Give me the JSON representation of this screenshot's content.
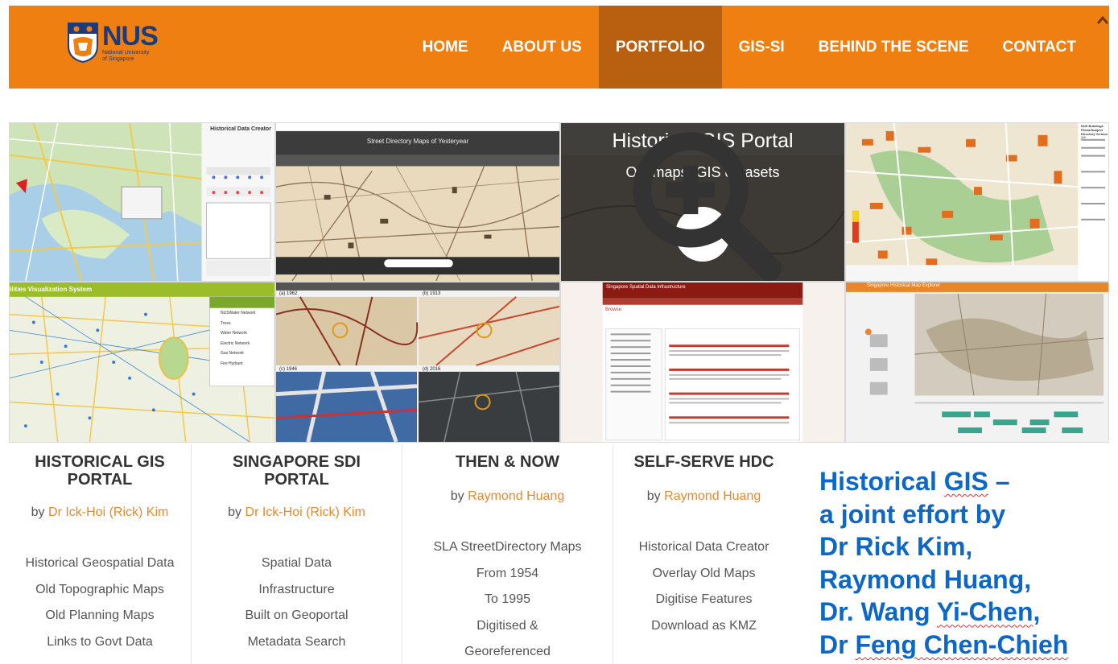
{
  "logo": {
    "name": "NUS",
    "subtitle_line1": "National University",
    "subtitle_line2": "of Singapore"
  },
  "nav": {
    "items": [
      "HOME",
      "ABOUT US",
      "PORTFOLIO",
      "GIS-SI",
      "BEHIND THE SCENE",
      "CONTACT"
    ],
    "active": "PORTFOLIO"
  },
  "colors": {
    "header": "#f07f12",
    "nav_active": "#b86010",
    "link": "#e68a2e",
    "credits": "#0c67c7"
  },
  "overlay": {
    "title": "Historical GIS Portal",
    "subtitle": "Old maps, GIS datasets",
    "icon": "zoom-in-icon"
  },
  "tiles": {
    "t1": {
      "panel_title": "Historical Data Creator"
    },
    "t2": {
      "banner_title": "Street Directory Maps of Yesteryear"
    },
    "t4": {
      "side_title": "NUS Buildings Photo/Subject Directory Version 1.0"
    },
    "t5": {
      "title": "ilities Visualization System",
      "layers": [
        "NUSWater Network",
        "Trees",
        "Water Network",
        "Electric Network",
        "Gas Network",
        "Fire Hydrant"
      ]
    },
    "t6": {
      "labels": [
        "(a) 1962",
        "(b) 1913",
        "(c) 1946",
        "(d) 2016"
      ]
    },
    "t7": {
      "title": "Singapore Spatial Data Infrastructure",
      "subtitle": "Browse"
    },
    "t8": {
      "title": "Singapore Historical Map Explorer"
    }
  },
  "columns": [
    {
      "title": "HISTORICAL GIS PORTAL",
      "by": "by",
      "author": "Dr Ick-Hoi (Rick) Kim",
      "items": [
        "Historical Geospatial Data",
        "Old Topographic Maps",
        "Old Planning Maps",
        "Links to Govt Data"
      ]
    },
    {
      "title": "SINGAPORE SDI PORTAL",
      "by": "by",
      "author": "Dr Ick-Hoi (Rick) Kim",
      "items": [
        "Spatial Data",
        "Infrastructure",
        "Built on Geoportal",
        "Metadata Search"
      ]
    },
    {
      "title": "THEN & NOW",
      "by": "by",
      "author": "Raymond Huang",
      "items": [
        "SLA StreetDirectory Maps",
        "From 1954",
        "To 1995",
        "Digitised &",
        "Georeferenced"
      ]
    },
    {
      "title": "SELF-SERVE HDC",
      "by": "by",
      "author": "Raymond Huang",
      "items": [
        "Historical Data Creator",
        "Overlay Old Maps",
        "Digitise Features",
        "Download as KMZ"
      ]
    }
  ],
  "credits": {
    "line1_a": "Historical ",
    "line1_b": "GIS",
    "line1_c": " –",
    "line2": "a joint effort by",
    "line3": "Dr Rick Kim,",
    "line4": "Raymond Huang,",
    "line5_a": "Dr. Wang ",
    "line5_b": "Yi-Chen",
    "line6_a": "Dr ",
    "line6_b": "Feng Chen-Chieh",
    "line5_c": ","
  }
}
